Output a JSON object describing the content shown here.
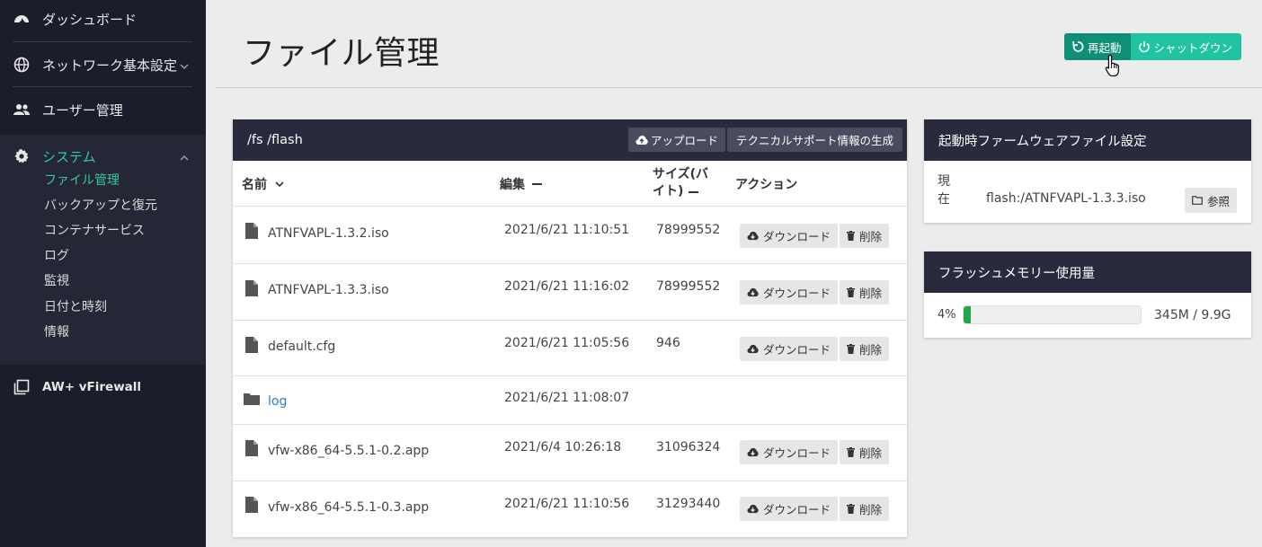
{
  "sidebar": {
    "dashboard": "ダッシュボード",
    "network": "ネットワーク基本設定",
    "users": "ユーザー管理",
    "system": "システム",
    "sub_items": [
      "ファイル管理",
      "バックアップと復元",
      "コンテナサービス",
      "ログ",
      "監視",
      "日付と時刻",
      "情報"
    ],
    "aw_vfirewall": "AW+ vFirewall"
  },
  "header": {
    "title": "ファイル管理",
    "restart_label": "再起動",
    "shutdown_label": "シャットダウン"
  },
  "files_card": {
    "path": "/fs /flash",
    "upload_label": "アップロード",
    "support_label": "テクニカルサポート情報の生成",
    "columns": {
      "name": "名前",
      "edited": "編集",
      "size_line1": "サイズ(バ",
      "size_line2": "イト)",
      "action": "アクション"
    },
    "download_label": "ダウンロード",
    "delete_label": "削除",
    "rows": [
      {
        "name": "ATNFVAPL-1.3.2.iso",
        "date": "2021/6/21 11:10:51",
        "size": "78999552"
      },
      {
        "name": "ATNFVAPL-1.3.3.iso",
        "date": "2021/6/21 11:16:02",
        "size": "78999552"
      },
      {
        "name": "default.cfg",
        "date": "2021/6/21 11:05:56",
        "size": "946"
      },
      {
        "name": "log",
        "date": "2021/6/21 11:08:07",
        "size": ""
      },
      {
        "name": "vfw-x86_64-5.5.1-0.2.app",
        "date": "2021/6/4 10:26:18",
        "size": "31096324"
      },
      {
        "name": "vfw-x86_64-5.5.1-0.3.app",
        "date": "2021/6/21 11:10:56",
        "size": "31293440"
      }
    ]
  },
  "firmware_card": {
    "title": "起動時ファームウェアファイル設定",
    "current_label_1": "現",
    "current_label_2": "在",
    "current_value": "flash:/ATNFVAPL-1.3.3.iso",
    "browse_label": "参照"
  },
  "flash_card": {
    "title": "フラッシュメモリー使用量",
    "percent_label": "4%",
    "percent_value": 0.04,
    "usage": "345M / 9.9G"
  },
  "colors": {
    "sidebar_bg": "#1c1d2b",
    "accent": "#33c9a4",
    "card_header": "#292a3d",
    "restart_btn": "#0f8f75",
    "shutdown_btn": "#21c4a2",
    "progress": "#22a84a",
    "link": "#2a7fc4"
  }
}
